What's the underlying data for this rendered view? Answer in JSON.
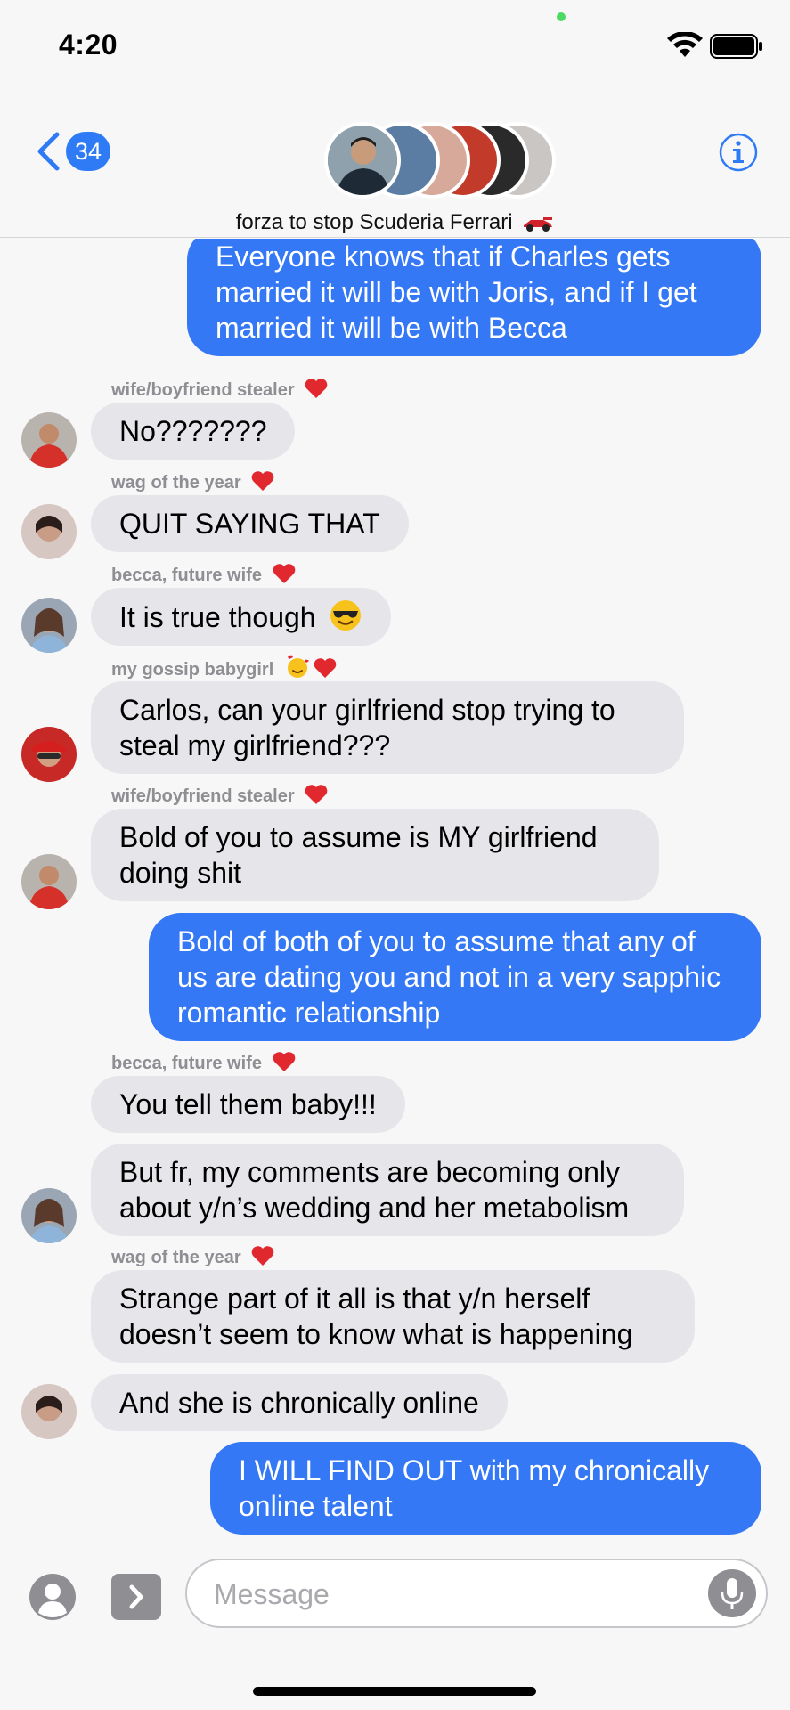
{
  "status": {
    "time": "4:20"
  },
  "header": {
    "back_count": "34",
    "group_name": "forza to stop Scuderia Ferrari"
  },
  "messages": [
    {
      "type": "out",
      "text": "Everyone knows that if Charles gets married it will be with Joris, and if I get married it will be with Becca"
    },
    {
      "type": "sender",
      "text": "wife/boyfriend stealer"
    },
    {
      "type": "in",
      "text": "No???????"
    },
    {
      "type": "sender",
      "text": "wag of the year"
    },
    {
      "type": "in",
      "text": "QUIT SAYING THAT"
    },
    {
      "type": "sender",
      "text": "becca, future wife"
    },
    {
      "type": "in",
      "text": "It is true though"
    },
    {
      "type": "sender",
      "text": "my gossip babygirl"
    },
    {
      "type": "in",
      "text": "Carlos, can your girlfriend stop trying to steal my girlfriend???"
    },
    {
      "type": "sender",
      "text": "wife/boyfriend stealer"
    },
    {
      "type": "in",
      "text": "Bold of you to assume is MY girlfriend doing shit"
    },
    {
      "type": "out",
      "text": "Bold of both of you to assume that any of us are dating you and not in a very sapphic romantic relationship"
    },
    {
      "type": "sender",
      "text": "becca, future wife"
    },
    {
      "type": "in",
      "text": "You tell them baby!!!"
    },
    {
      "type": "in",
      "text": "But fr, my comments are becoming only about y/n’s wedding and her metabolism"
    },
    {
      "type": "sender",
      "text": "wag of the year"
    },
    {
      "type": "in",
      "text": "Strange part of it all is that y/n herself doesn’t seem to know what is happening"
    },
    {
      "type": "in",
      "text": "And she is chronically online"
    },
    {
      "type": "out",
      "text": "I WILL FIND OUT with my chronically online talent"
    }
  ],
  "input": {
    "placeholder": "Message"
  },
  "colors": {
    "accent": "#3478f6",
    "incoming": "#e6e6ea",
    "heart": "#e0282e"
  }
}
